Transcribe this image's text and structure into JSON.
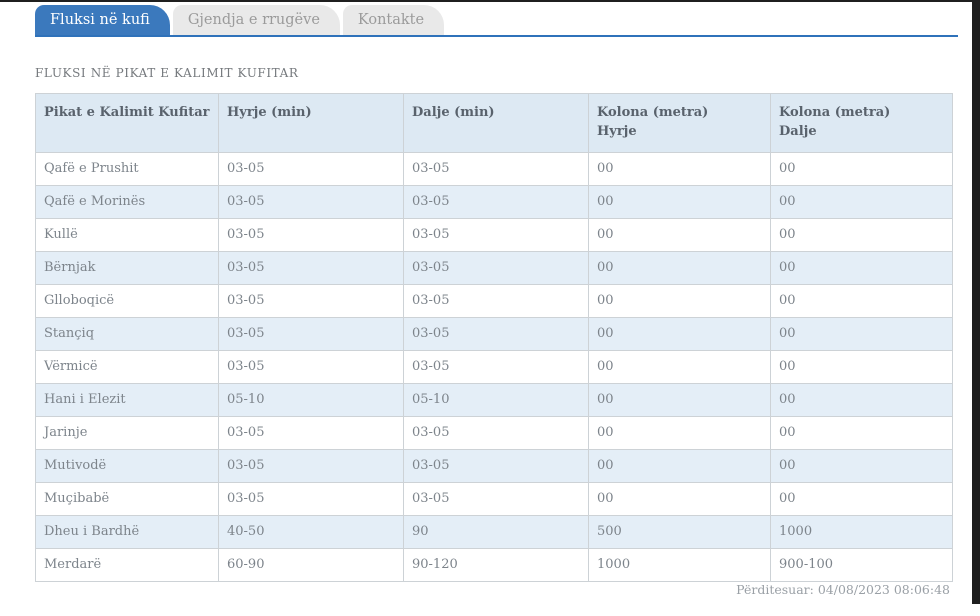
{
  "colors": {
    "active_tab_bg": "#3b79bd",
    "active_tab_text": "#ffffff",
    "inactive_tab_bg": "#e9e9e9",
    "inactive_tab_text": "#9b9b9b",
    "tab_underline": "#2f72ba",
    "table_header_bg": "#dde9f3",
    "table_alt_row_bg": "#e4eef7",
    "table_border": "#cdd2d6",
    "window_edge": "#1f1f1f"
  },
  "tabs": [
    {
      "label": "Fluksi në kufi",
      "active": true
    },
    {
      "label": "Gjendja e rrugëve",
      "active": false
    },
    {
      "label": "Kontakte",
      "active": false
    }
  ],
  "page": {
    "heading": "FLUKSI NË PIKAT E KALIMIT KUFITAR"
  },
  "table": {
    "columns": [
      "Pikat e Kalimit Kufitar",
      "Hyrje (min)",
      "Dalje (min)",
      "Kolona (metra)\nHyrje",
      "Kolona (metra)\nDalje"
    ],
    "rows": [
      [
        "Qafë e Prushit",
        "03-05",
        "03-05",
        "00",
        "00"
      ],
      [
        "Qafë e Morinës",
        "03-05",
        "03-05",
        "00",
        "00"
      ],
      [
        "Kullë",
        "03-05",
        "03-05",
        "00",
        "00"
      ],
      [
        "Bërnjak",
        "03-05",
        "03-05",
        "00",
        "00"
      ],
      [
        "Glloboqicë",
        "03-05",
        "03-05",
        "00",
        "00"
      ],
      [
        "Stançiq",
        "03-05",
        "03-05",
        "00",
        "00"
      ],
      [
        "Vërmicë",
        "03-05",
        "03-05",
        "00",
        "00"
      ],
      [
        "Hani i Elezit",
        "05-10",
        "05-10",
        "00",
        "00"
      ],
      [
        "Jarinje",
        "03-05",
        "03-05",
        "00",
        "00"
      ],
      [
        "Mutivodë",
        "03-05",
        "03-05",
        "00",
        "00"
      ],
      [
        "Muçibabë",
        "03-05",
        "03-05",
        "00",
        "00"
      ],
      [
        "Dheu i Bardhë",
        "40-50",
        "90",
        "500",
        "1000"
      ],
      [
        "Merdarë",
        "60-90",
        "90-120",
        "1000",
        "900-100"
      ]
    ]
  },
  "footer": {
    "updated": "Përditesuar: 04/08/2023 08:06:48"
  }
}
